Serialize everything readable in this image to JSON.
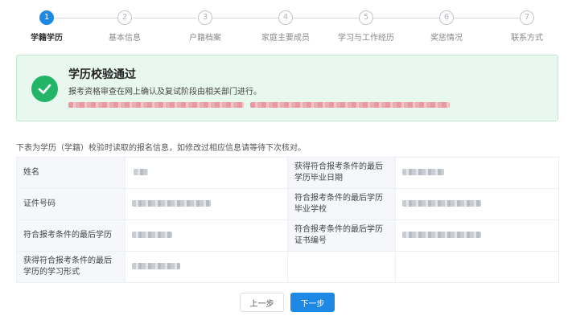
{
  "steps": [
    {
      "number": "1",
      "label": "学籍学历",
      "active": true
    },
    {
      "number": "2",
      "label": "基本信息",
      "active": false
    },
    {
      "number": "3",
      "label": "户籍档案",
      "active": false
    },
    {
      "number": "4",
      "label": "家庭主要成员",
      "active": false
    },
    {
      "number": "5",
      "label": "学习与工作经历",
      "active": false
    },
    {
      "number": "6",
      "label": "奖惩情况",
      "active": false
    },
    {
      "number": "7",
      "label": "联系方式",
      "active": false
    }
  ],
  "banner": {
    "title": "学历校验通过",
    "description": "报考资格审查在网上确认及复试阶段由相关部门进行。",
    "icon": "check-circle-icon",
    "color": "#22b567"
  },
  "note": "下表为学历（学籍）校验时读取的报名信息，如修改过相应信息请等待下次核对。",
  "table": {
    "rows": [
      {
        "label1": "姓名",
        "label2": "获得符合报考条件的最后学历毕业日期"
      },
      {
        "label1": "证件号码",
        "label2": "符合报考条件的最后学历毕业学校"
      },
      {
        "label1": "符合报考条件的最后学历",
        "label2": "符合报考条件的最后学历证书编号"
      },
      {
        "label1": "获得符合报考条件的最后学历的学习形式",
        "label2": ""
      }
    ]
  },
  "buttons": {
    "prev": "上一步",
    "next": "下一步"
  },
  "colors": {
    "accent": "#1e88e5",
    "success": "#22b567",
    "success_bg": "#e8f8ef"
  }
}
